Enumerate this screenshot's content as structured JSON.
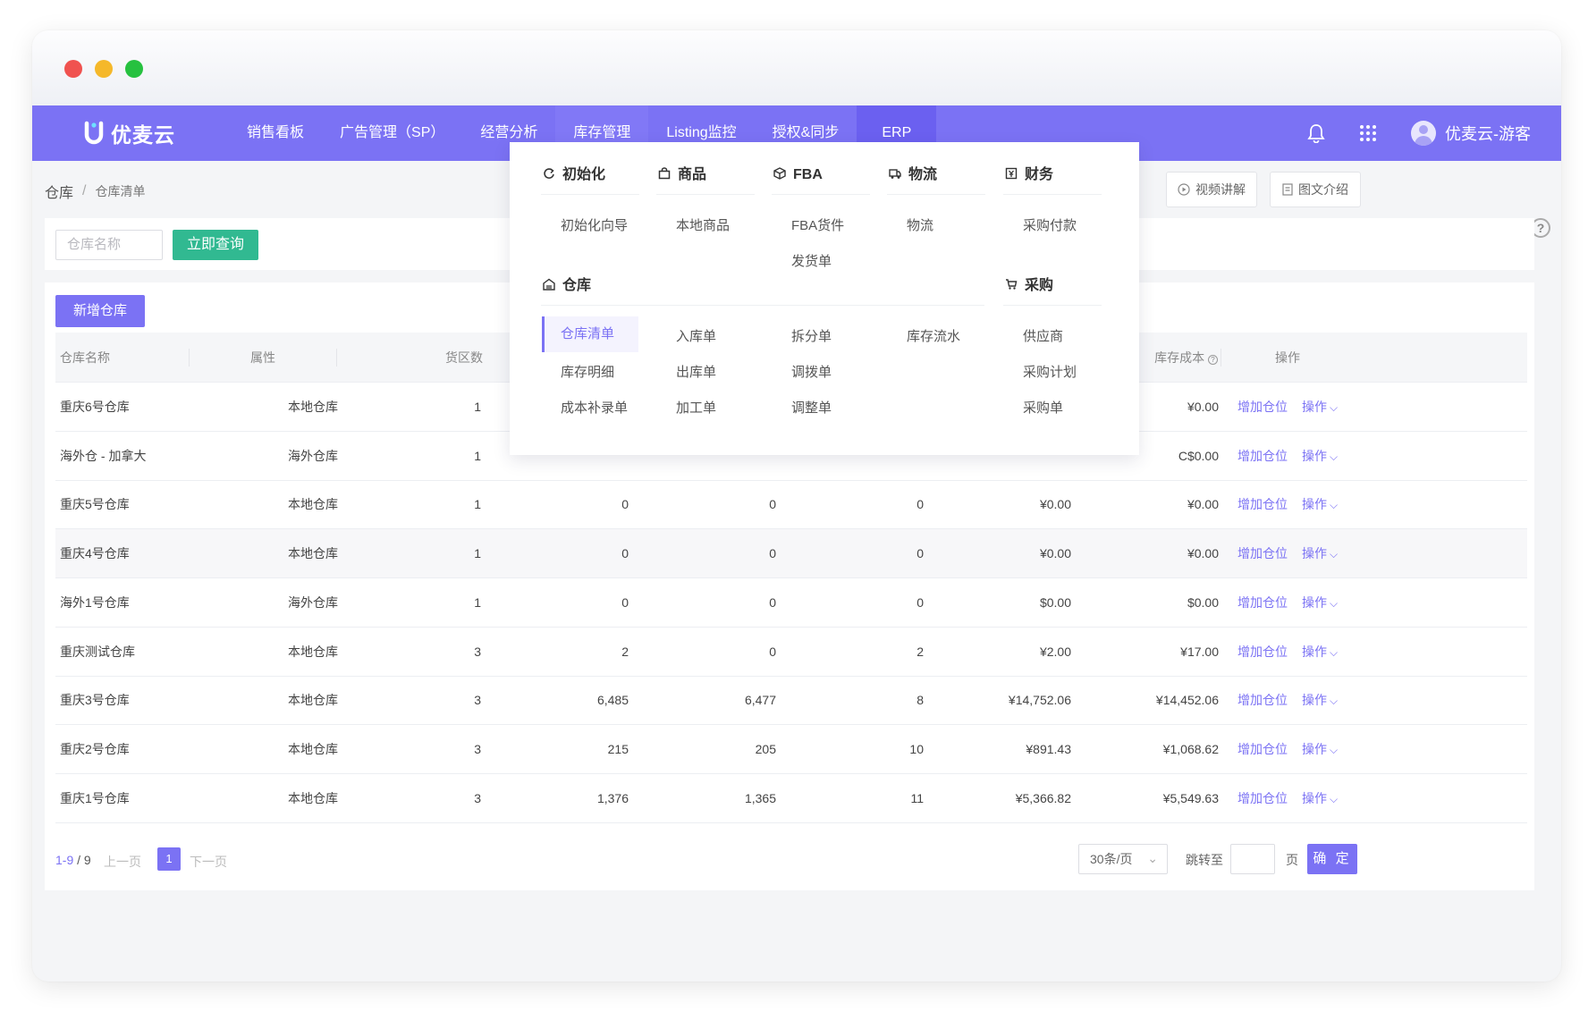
{
  "window": {
    "controls": [
      "close",
      "minimize",
      "maximize"
    ]
  },
  "nav": {
    "logo_text": "优麦云",
    "items": [
      "销售看板",
      "广告管理（SP）",
      "经营分析",
      "库存管理",
      "Listing监控",
      "授权&同步",
      "ERP"
    ],
    "active_item": "ERP",
    "user_name": "优麦云-游客"
  },
  "breadcrumb": {
    "root": "仓库",
    "separator": "/",
    "current": "仓库清单"
  },
  "top_buttons": {
    "video": "视频讲解",
    "guide": "图文介绍"
  },
  "filter": {
    "placeholder": "仓库名称",
    "search_button": "立即查询"
  },
  "actions": {
    "add_button": "新增仓库"
  },
  "table": {
    "columns": [
      "仓库名称",
      "属性",
      "货区数",
      "",
      "",
      "",
      "",
      "库存成本",
      "操作"
    ],
    "rows": [
      {
        "name": "重庆6号仓库",
        "attr": "本地仓库",
        "zones": "1",
        "c4": "",
        "c5": "",
        "c6": "",
        "c7": "",
        "cost": "¥0.00"
      },
      {
        "name": "海外仓 - 加拿大",
        "attr": "海外仓库",
        "zones": "1",
        "c4": "",
        "c5": "",
        "c6": "",
        "c7": "",
        "cost": "C$0.00"
      },
      {
        "name": "重庆5号仓库",
        "attr": "本地仓库",
        "zones": "1",
        "c4": "0",
        "c5": "0",
        "c6": "0",
        "c7": "¥0.00",
        "cost": "¥0.00"
      },
      {
        "name": "重庆4号仓库",
        "attr": "本地仓库",
        "zones": "1",
        "c4": "0",
        "c5": "0",
        "c6": "0",
        "c7": "¥0.00",
        "cost": "¥0.00"
      },
      {
        "name": "海外1号仓库",
        "attr": "海外仓库",
        "zones": "1",
        "c4": "0",
        "c5": "0",
        "c6": "0",
        "c7": "$0.00",
        "cost": "$0.00"
      },
      {
        "name": "重庆测试仓库",
        "attr": "本地仓库",
        "zones": "3",
        "c4": "2",
        "c5": "0",
        "c6": "2",
        "c7": "¥2.00",
        "cost": "¥17.00"
      },
      {
        "name": "重庆3号仓库",
        "attr": "本地仓库",
        "zones": "3",
        "c4": "6,485",
        "c5": "6,477",
        "c6": "8",
        "c7": "¥14,752.06",
        "cost": "¥14,452.06"
      },
      {
        "name": "重庆2号仓库",
        "attr": "本地仓库",
        "zones": "3",
        "c4": "215",
        "c5": "205",
        "c6": "10",
        "c7": "¥891.43",
        "cost": "¥1,068.62"
      },
      {
        "name": "重庆1号仓库",
        "attr": "本地仓库",
        "zones": "3",
        "c4": "1,376",
        "c5": "1,365",
        "c6": "11",
        "c7": "¥5,366.82",
        "cost": "¥5,549.63"
      }
    ],
    "row_actions": {
      "add_slot": "增加仓位",
      "more": "操作"
    }
  },
  "pager": {
    "range": "1-9",
    "total": "9",
    "prev": "上一页",
    "current": "1",
    "next": "下一页",
    "page_size": "30条/页",
    "jump_label": "跳转至",
    "page_label": "页",
    "ok": "确 定"
  },
  "dropdown": {
    "categories": {
      "init": "初始化",
      "goods": "商品",
      "fba": "FBA",
      "logistics": "物流",
      "finance": "财务",
      "warehouse": "仓库",
      "purchase": "采购"
    },
    "items": {
      "init_wizard": "初始化向导",
      "local_goods": "本地商品",
      "fba_shipment": "FBA货件",
      "delivery_order": "发货单",
      "logistics": "物流",
      "purchase_payment": "采购付款",
      "warehouse_list": "仓库清单",
      "stock_in": "入库单",
      "split_order": "拆分单",
      "stock_flow": "库存流水",
      "supplier": "供应商",
      "stock_detail": "库存明细",
      "stock_out": "出库单",
      "transfer_order": "调拨单",
      "purchase_plan": "采购计划",
      "cost_adjust": "成本补录单",
      "processing_order": "加工单",
      "adjust_order": "调整单",
      "purchase_order": "采购单"
    },
    "active": "仓库清单"
  },
  "colors": {
    "primary": "#7b72f4",
    "teal": "#31b991"
  }
}
